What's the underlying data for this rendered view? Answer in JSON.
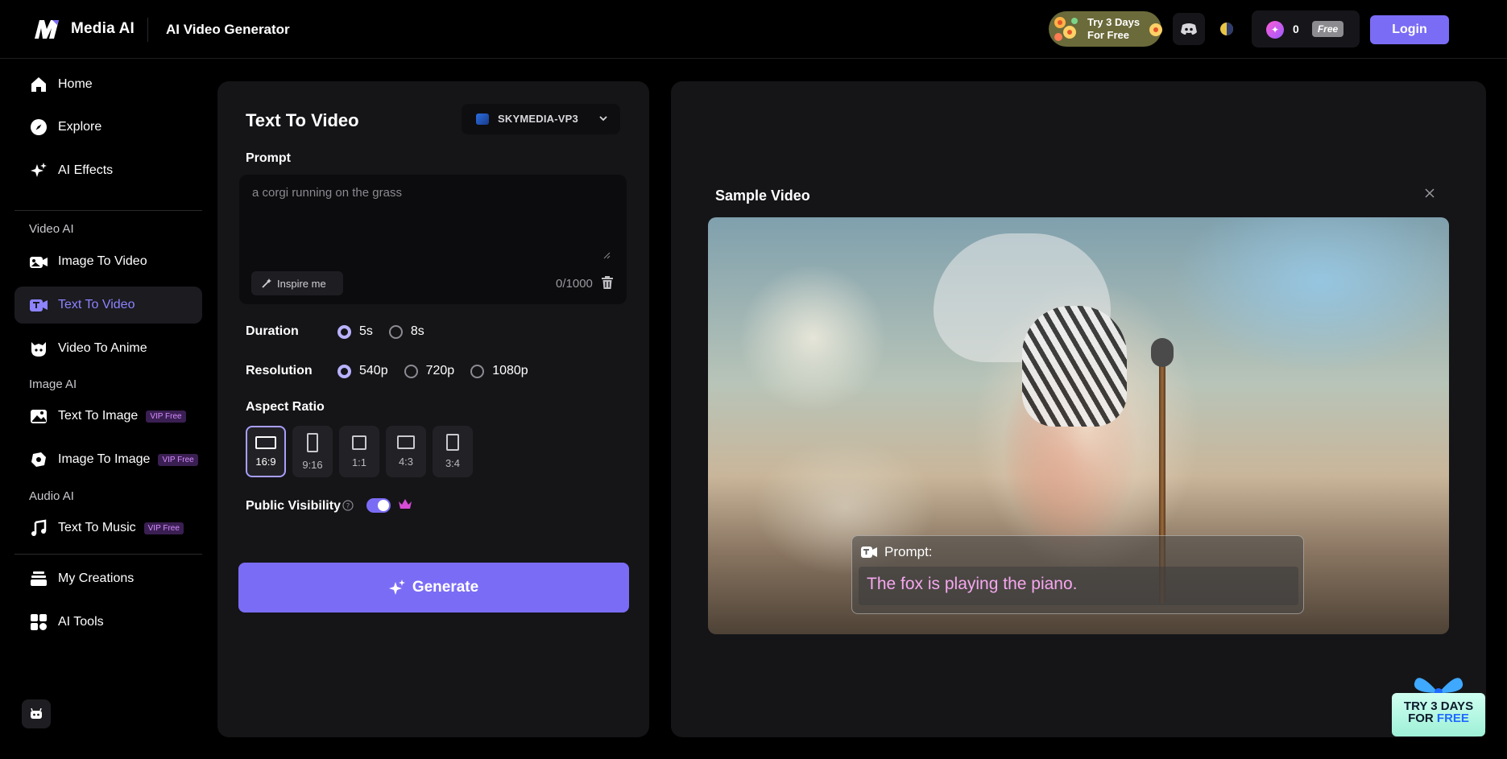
{
  "header": {
    "brand": "Media AI",
    "title": "AI Video Generator",
    "trial_line1": "Try 3 Days",
    "trial_line2": "For Free",
    "credits": "0",
    "plan_badge": "Free",
    "login_label": "Login"
  },
  "sidebar": {
    "home": "Home",
    "explore": "Explore",
    "ai_effects": "AI Effects",
    "section_video": "Video AI",
    "image_to_video": "Image To Video",
    "text_to_video": "Text To Video",
    "video_to_anime": "Video To Anime",
    "section_image": "Image AI",
    "text_to_image": "Text To Image",
    "image_to_image": "Image To Image",
    "section_audio": "Audio AI",
    "text_to_music": "Text To Music",
    "vip_badge": "VIP Free",
    "my_creations": "My Creations",
    "ai_tools": "AI Tools"
  },
  "panel": {
    "title": "Text To Video",
    "model": "SKYMEDIA-VP3",
    "prompt_label": "Prompt",
    "prompt_placeholder": "a corgi running on the grass",
    "inspire_label": "Inspire me",
    "counter": "0/1000",
    "duration_label": "Duration",
    "durations": [
      "5s",
      "8s"
    ],
    "duration_selected": "5s",
    "resolution_label": "Resolution",
    "resolutions": [
      "540p",
      "720p",
      "1080p"
    ],
    "resolution_selected": "540p",
    "aspect_label": "Aspect Ratio",
    "aspects": [
      "16:9",
      "9:16",
      "1:1",
      "4:3",
      "3:4"
    ],
    "aspect_selected": "16:9",
    "visibility_label": "Public Visibility",
    "visibility_on": true,
    "generate_label": "Generate"
  },
  "sample": {
    "title": "Sample Video",
    "caption_label": "Prompt:",
    "caption_text": "The fox is playing the piano."
  },
  "promo": {
    "line1": "TRY 3 DAYS",
    "line2_a": "FOR ",
    "line2_b": "FREE"
  },
  "colors": {
    "accent": "#7b6cf6",
    "active_text": "#8d83ff",
    "vip": "#d58cff",
    "caption": "#f6a7ef"
  }
}
